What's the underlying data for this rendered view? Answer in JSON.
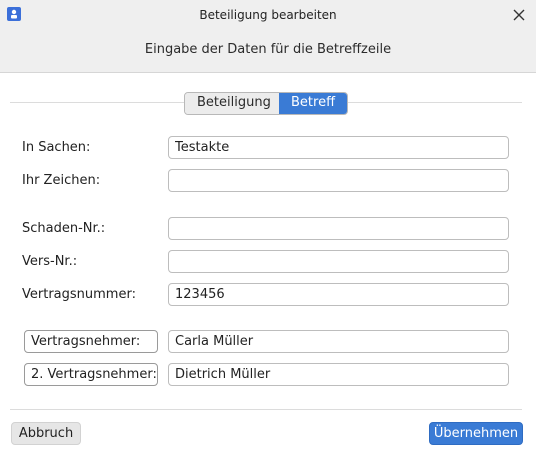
{
  "window": {
    "title": "Beteiligung bearbeiten",
    "icon": "app-icon"
  },
  "header": {
    "subtitle": "Eingabe der Daten für die Betreffzeile"
  },
  "tabs": [
    {
      "label": "Beteiligung",
      "active": false
    },
    {
      "label": "Betreff",
      "active": true
    }
  ],
  "form": {
    "in_sachen": {
      "label": "In Sachen:",
      "value": "Testakte"
    },
    "ihr_zeichen": {
      "label": "Ihr Zeichen:",
      "value": ""
    },
    "schaden_nr": {
      "label": "Schaden-Nr.:",
      "value": ""
    },
    "vers_nr": {
      "label": "Vers-Nr.:",
      "value": ""
    },
    "vertragsnummer": {
      "label": "Vertragsnummer:",
      "value": "123456"
    },
    "vertragsnehmer": {
      "label": "Vertragsnehmer:",
      "value": "Carla Müller"
    },
    "vertragsnehmer2": {
      "label": "2. Vertragsnehmer:",
      "value": "Dietrich Müller"
    }
  },
  "buttons": {
    "cancel": "Abbruch",
    "ok": "Übernehmen"
  },
  "colors": {
    "accent": "#3a7bd5",
    "titlebar": "#efefef"
  }
}
